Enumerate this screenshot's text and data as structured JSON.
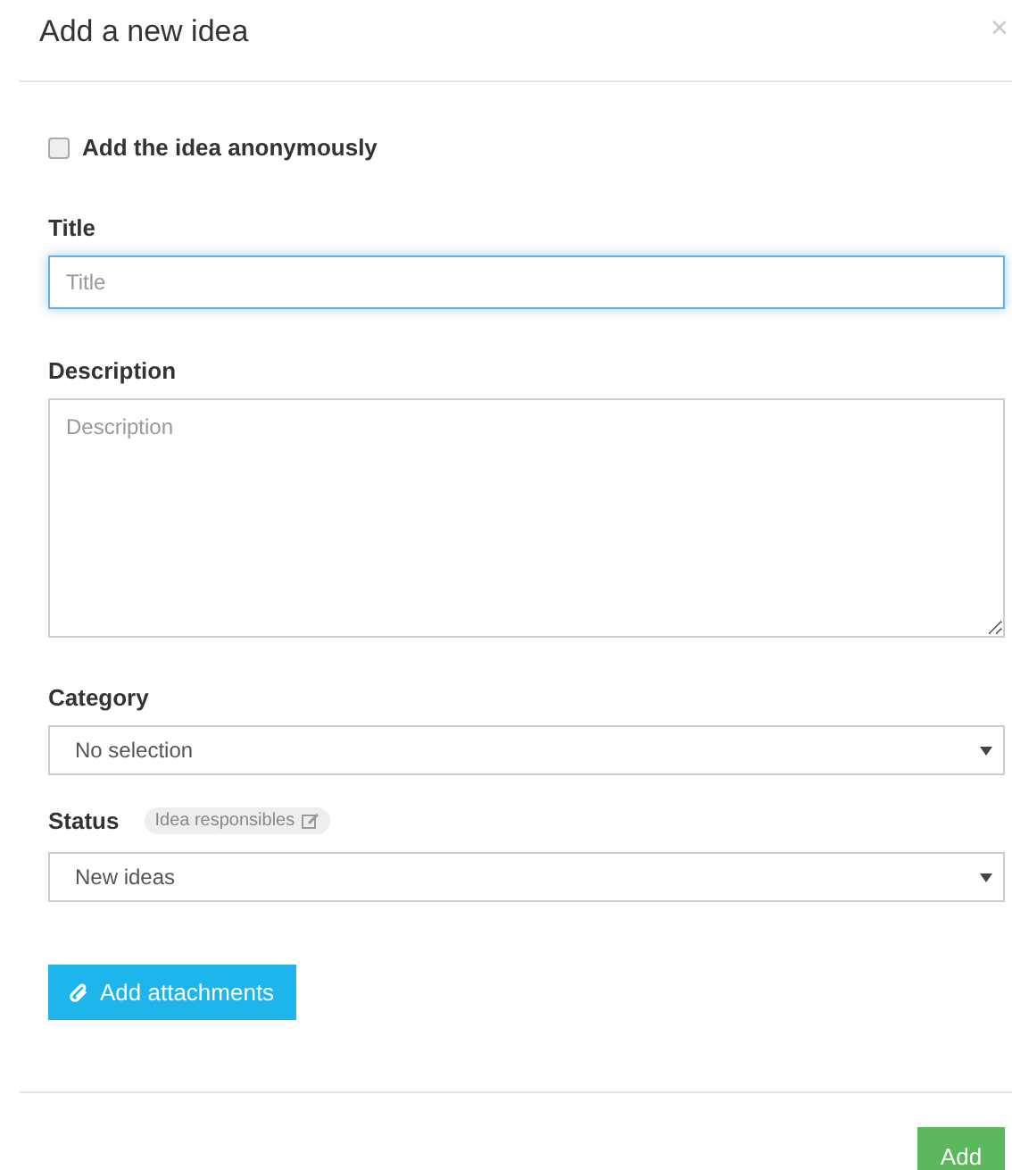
{
  "dialog": {
    "title": "Add a new idea",
    "close": "×"
  },
  "anonymous": {
    "label": "Add the idea anonymously",
    "checked": false
  },
  "title_field": {
    "label": "Title",
    "placeholder": "Title",
    "focused": true
  },
  "description_field": {
    "label": "Description",
    "placeholder": "Description"
  },
  "category_field": {
    "label": "Category",
    "value": "No selection"
  },
  "status_field": {
    "label": "Status",
    "badge": "Idea responsibles",
    "value": "New ideas"
  },
  "attach_button": {
    "label": "Add attachments"
  },
  "footer": {
    "submit": "Add"
  }
}
